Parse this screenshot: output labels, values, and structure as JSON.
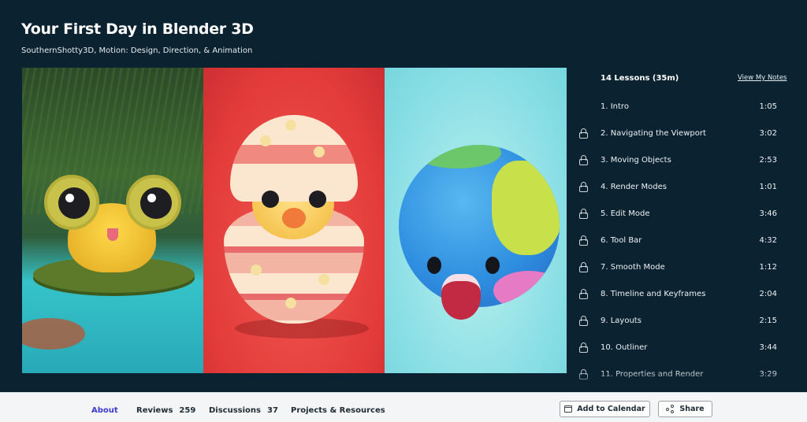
{
  "course": {
    "title": "Your First Day in Blender 3D",
    "subtitle": "SouthernShotty3D, Motion: Design, Direction, & Animation"
  },
  "lessons_panel": {
    "heading": "14 Lessons (35m)",
    "notes_link": "View My Notes",
    "items": [
      {
        "title": "1. Intro",
        "duration": "1:05",
        "locked": false
      },
      {
        "title": "2. Navigating the Viewport",
        "duration": "3:02",
        "locked": true
      },
      {
        "title": "3. Moving Objects",
        "duration": "2:53",
        "locked": true
      },
      {
        "title": "4. Render Modes",
        "duration": "1:01",
        "locked": true
      },
      {
        "title": "5. Edit Mode",
        "duration": "3:46",
        "locked": true
      },
      {
        "title": "6. Tool Bar",
        "duration": "4:32",
        "locked": true
      },
      {
        "title": "7. Smooth Mode",
        "duration": "1:12",
        "locked": true
      },
      {
        "title": "8. Timeline and Keyframes",
        "duration": "2:04",
        "locked": true
      },
      {
        "title": "9. Layouts",
        "duration": "2:15",
        "locked": true
      },
      {
        "title": "10. Outliner",
        "duration": "3:44",
        "locked": true
      },
      {
        "title": "11. Properties and Render",
        "duration": "3:29",
        "locked": true
      }
    ]
  },
  "bottom_bar": {
    "tabs": [
      {
        "label": "About",
        "count": "",
        "active": true
      },
      {
        "label": "Reviews",
        "count": "259",
        "active": false
      },
      {
        "label": "Discussions",
        "count": "37",
        "active": false
      },
      {
        "label": "Projects & Resources",
        "count": "",
        "active": false
      }
    ],
    "add_to_calendar": "Add to Calendar",
    "share": "Share"
  },
  "colors": {
    "background": "#0b2230",
    "active_tab": "#3b3bcf",
    "bottom_bar": "#f4f5f6"
  },
  "icons": [
    "lock-icon",
    "calendar-icon",
    "share-icon"
  ]
}
